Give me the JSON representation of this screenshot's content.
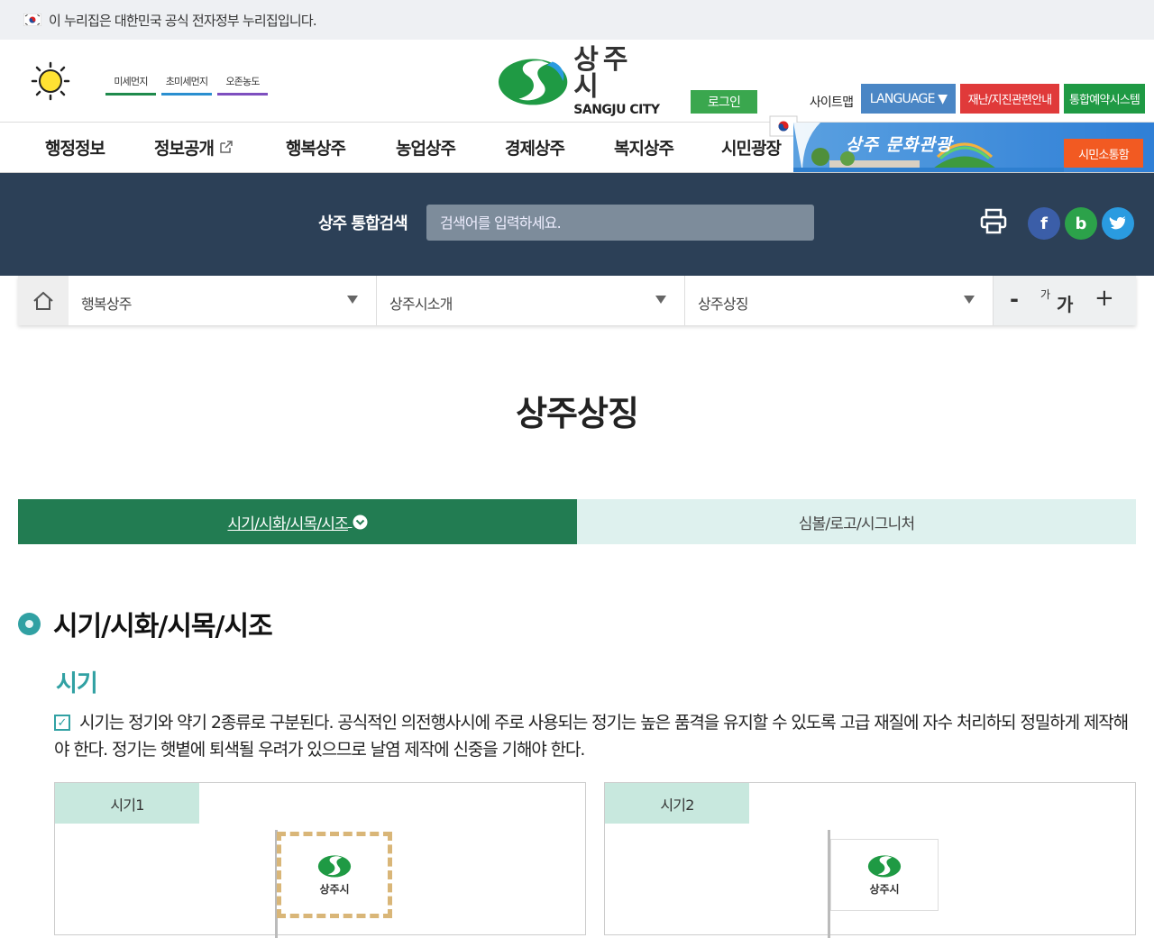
{
  "gov_notice": "이 누리집은 대한민국 공식 전자정부 누리집입니다.",
  "header": {
    "air": [
      {
        "label": "미세먼지",
        "color": "#1f8a4c"
      },
      {
        "label": "초미세먼지",
        "color": "#2a8fd0"
      },
      {
        "label": "오존농도",
        "color": "#7e4fbf"
      }
    ],
    "logo_ko": "상주시",
    "logo_en": "SANGJU CITY",
    "login": "로그인",
    "sitemap": "사이트맵",
    "language": "LANGUAGE ▼",
    "disaster": "재난/지진관련안내",
    "reservation": "통합예약시스템"
  },
  "nav": {
    "items": [
      "행정정보",
      "정보공개",
      "행복상주",
      "농업상주",
      "경제상주",
      "복지상주",
      "시민광장"
    ],
    "banner_title": "상주 문화관광",
    "civic_button": "시민소통함"
  },
  "search": {
    "label": "상주 통합검색",
    "placeholder": "검색어를 입력하세요."
  },
  "breadcrumb": {
    "level1": "행복상주",
    "level2": "상주시소개",
    "level3": "상주상징",
    "zoom_out": "-",
    "zoom_small": "가",
    "zoom_large": "가",
    "zoom_in": "+"
  },
  "page_title": "상주상징",
  "tabs": {
    "active": "시기/시화/시목/시조",
    "inactive": "심볼/로고/시그니처"
  },
  "section": {
    "heading": "시기/시화/시목/시조",
    "sub": "시기",
    "paragraph": "시기는 정기와 약기 2종류로 구분된다. 공식적인 의전행사시에 주로 사용되는 정기는 높은 품격을 유지할 수 있도록 고급 재질에 자수 처리하되 정밀하게 제작해야 한다. 정기는 햇볕에 퇴색될 우려가 있으므로 날염 제작에 신중을 기해야 한다.",
    "cards": [
      {
        "label": "시기1",
        "flag_text": "상주시"
      },
      {
        "label": "시기2",
        "flag_text": "상주시"
      }
    ]
  },
  "colors": {
    "green": "#227c52",
    "teal": "#31a1a3",
    "navy": "#2c4057",
    "red": "#e03a3a",
    "blue_btn": "#4a86c5"
  }
}
